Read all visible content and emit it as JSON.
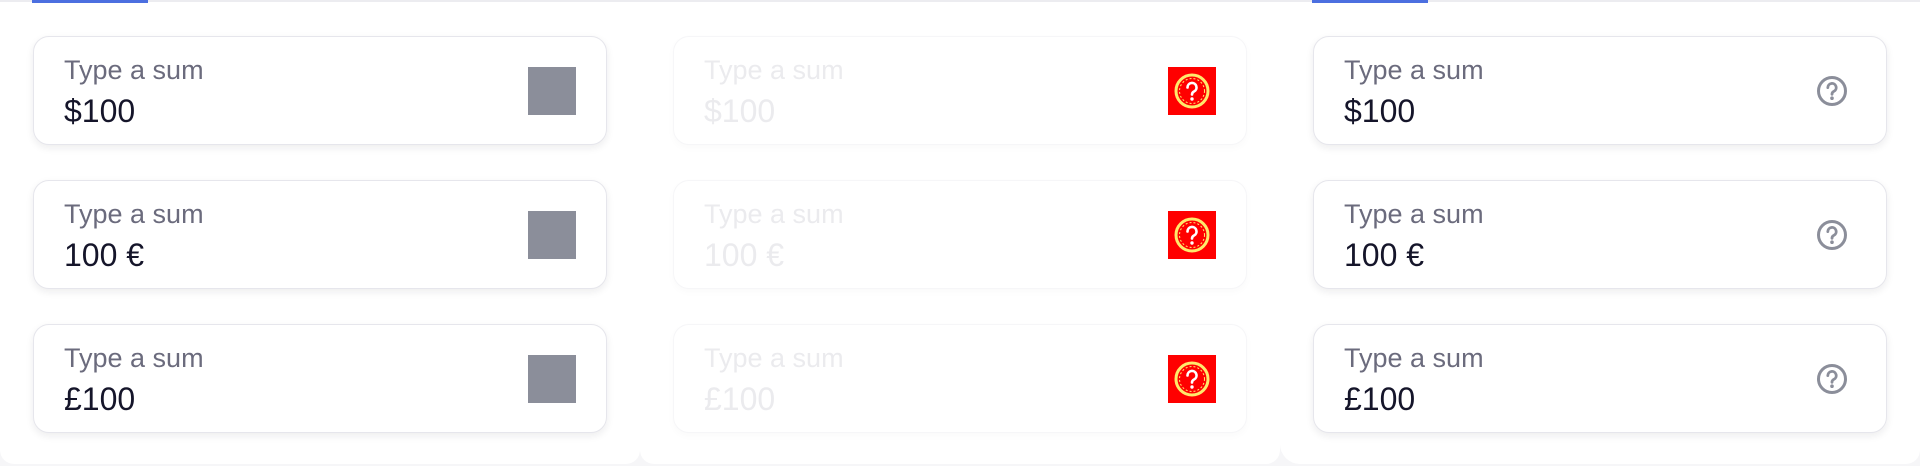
{
  "field_label": "Type a sum",
  "values": [
    "$100",
    "100 €",
    "£100"
  ],
  "panels": [
    {
      "name": "default",
      "icon": "placeholder-square-icon",
      "disabled": false,
      "active_tab": true
    },
    {
      "name": "disabled",
      "icon": "broken-help-icon",
      "disabled": true,
      "active_tab": false
    },
    {
      "name": "help",
      "icon": "help-circle-icon",
      "disabled": false,
      "active_tab": true
    }
  ],
  "colors": {
    "accent": "#4c6fe0",
    "label": "#6b6b7d",
    "value": "#15152a",
    "icon_gray": "#8b8e9a",
    "broken_icon_bg": "#ff0000",
    "disabled_text": "#ebebee"
  }
}
